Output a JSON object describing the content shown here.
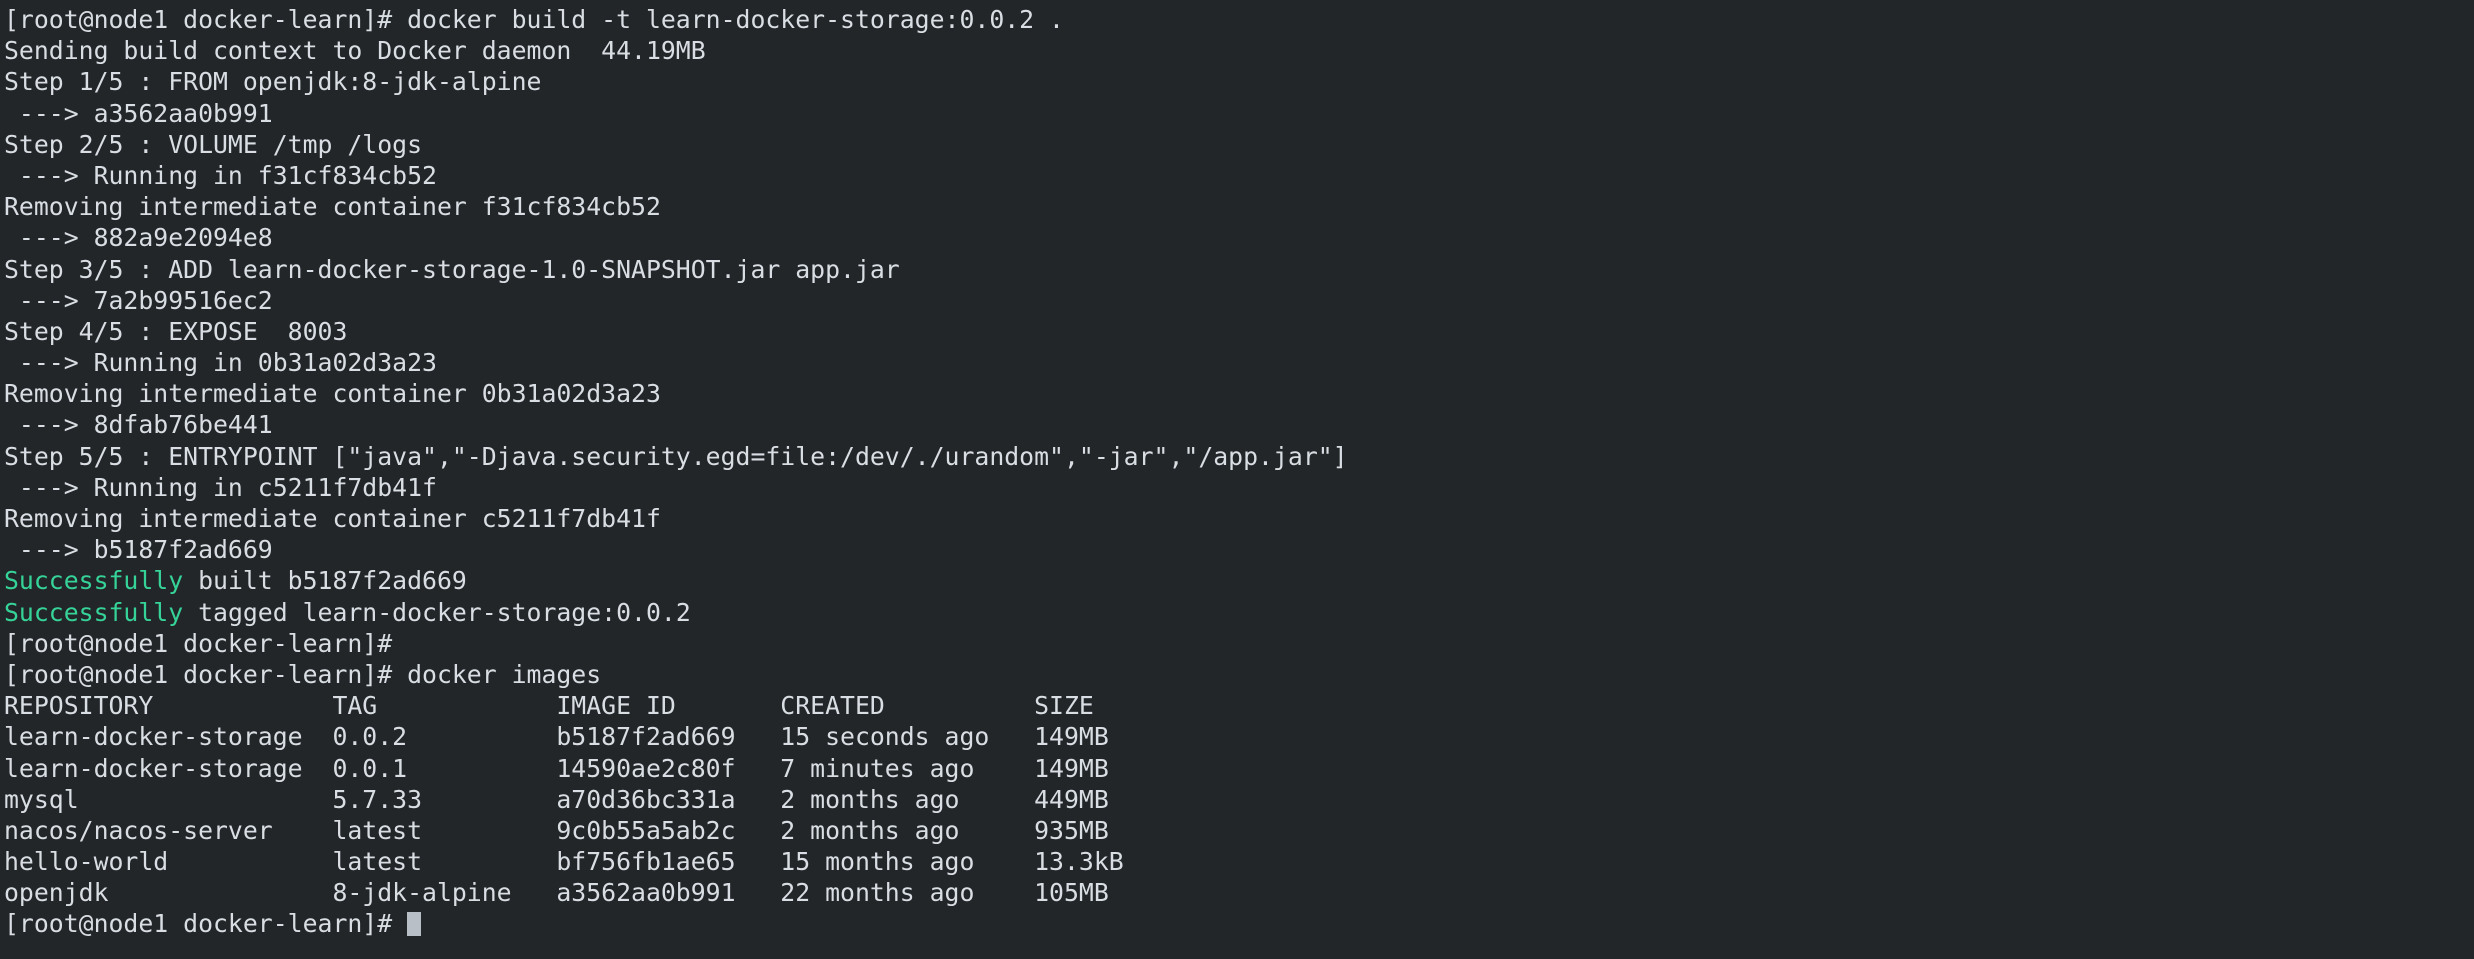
{
  "terminal": {
    "background": "#232629",
    "foreground": "#d8dee3",
    "success_color": "#36d399",
    "cursor_color": "#b9bfc6",
    "prompt": "[root@node1 docker-learn]#",
    "commands": {
      "build": "docker build -t learn-docker-storage:0.0.2 .",
      "images": "docker images"
    },
    "lines": [
      {
        "id": "line-1",
        "segments": [
          {
            "text": "[root@node1 docker-learn]# docker build -t learn-docker-storage:0.0.2 .",
            "color": "default"
          }
        ]
      },
      {
        "id": "line-2",
        "segments": [
          {
            "text": "Sending build context to Docker daemon  44.19MB",
            "color": "default"
          }
        ]
      },
      {
        "id": "line-3",
        "segments": [
          {
            "text": "Step 1/5 : FROM openjdk:8-jdk-alpine",
            "color": "default"
          }
        ]
      },
      {
        "id": "line-4",
        "segments": [
          {
            "text": " ---> a3562aa0b991",
            "color": "default"
          }
        ]
      },
      {
        "id": "line-5",
        "segments": [
          {
            "text": "Step 2/5 : VOLUME /tmp /logs",
            "color": "default"
          }
        ]
      },
      {
        "id": "line-6",
        "segments": [
          {
            "text": " ---> Running in f31cf834cb52",
            "color": "default"
          }
        ]
      },
      {
        "id": "line-7",
        "segments": [
          {
            "text": "Removing intermediate container f31cf834cb52",
            "color": "default"
          }
        ]
      },
      {
        "id": "line-8",
        "segments": [
          {
            "text": " ---> 882a9e2094e8",
            "color": "default"
          }
        ]
      },
      {
        "id": "line-9",
        "segments": [
          {
            "text": "Step 3/5 : ADD learn-docker-storage-1.0-SNAPSHOT.jar app.jar",
            "color": "default"
          }
        ]
      },
      {
        "id": "line-10",
        "segments": [
          {
            "text": " ---> 7a2b99516ec2",
            "color": "default"
          }
        ]
      },
      {
        "id": "line-11",
        "segments": [
          {
            "text": "Step 4/5 : EXPOSE  8003",
            "color": "default"
          }
        ]
      },
      {
        "id": "line-12",
        "segments": [
          {
            "text": " ---> Running in 0b31a02d3a23",
            "color": "default"
          }
        ]
      },
      {
        "id": "line-13",
        "segments": [
          {
            "text": "Removing intermediate container 0b31a02d3a23",
            "color": "default"
          }
        ]
      },
      {
        "id": "line-14",
        "segments": [
          {
            "text": " ---> 8dfab76be441",
            "color": "default"
          }
        ]
      },
      {
        "id": "line-15",
        "segments": [
          {
            "text": "Step 5/5 : ENTRYPOINT [\"java\",\"-Djava.security.egd=file:/dev/./urandom\",\"-jar\",\"/app.jar\"]",
            "color": "default"
          }
        ]
      },
      {
        "id": "line-16",
        "segments": [
          {
            "text": " ---> Running in c5211f7db41f",
            "color": "default"
          }
        ]
      },
      {
        "id": "line-17",
        "segments": [
          {
            "text": "Removing intermediate container c5211f7db41f",
            "color": "default"
          }
        ]
      },
      {
        "id": "line-18",
        "segments": [
          {
            "text": " ---> b5187f2ad669",
            "color": "default"
          }
        ]
      },
      {
        "id": "line-19",
        "segments": [
          {
            "text": "Successfully",
            "color": "green"
          },
          {
            "text": " built b5187f2ad669",
            "color": "default"
          }
        ]
      },
      {
        "id": "line-20",
        "segments": [
          {
            "text": "Successfully",
            "color": "green"
          },
          {
            "text": " tagged learn-docker-storage:0.0.2",
            "color": "default"
          }
        ]
      },
      {
        "id": "line-21",
        "segments": [
          {
            "text": "[root@node1 docker-learn]#",
            "color": "default"
          }
        ]
      },
      {
        "id": "line-22",
        "segments": [
          {
            "text": "[root@node1 docker-learn]# docker images",
            "color": "default"
          }
        ]
      },
      {
        "id": "line-23",
        "segments": [
          {
            "text": "REPOSITORY            TAG            IMAGE ID       CREATED          SIZE",
            "color": "default"
          }
        ]
      },
      {
        "id": "line-24",
        "segments": [
          {
            "text": "learn-docker-storage  0.0.2          b5187f2ad669   15 seconds ago   149MB",
            "color": "default"
          }
        ]
      },
      {
        "id": "line-25",
        "segments": [
          {
            "text": "learn-docker-storage  0.0.1          14590ae2c80f   7 minutes ago    149MB",
            "color": "default"
          }
        ]
      },
      {
        "id": "line-26",
        "segments": [
          {
            "text": "mysql                 5.7.33         a70d36bc331a   2 months ago     449MB",
            "color": "default"
          }
        ]
      },
      {
        "id": "line-27",
        "segments": [
          {
            "text": "nacos/nacos-server    latest         9c0b55a5ab2c   2 months ago     935MB",
            "color": "default"
          }
        ]
      },
      {
        "id": "line-28",
        "segments": [
          {
            "text": "hello-world           latest         bf756fb1ae65   15 months ago    13.3kB",
            "color": "default"
          }
        ]
      },
      {
        "id": "line-29",
        "segments": [
          {
            "text": "openjdk               8-jdk-alpine   a3562aa0b991   22 months ago    105MB",
            "color": "default"
          }
        ]
      }
    ],
    "final_prompt": "[root@node1 docker-learn]# ",
    "images_table": {
      "columns": [
        "REPOSITORY",
        "TAG",
        "IMAGE ID",
        "CREATED",
        "SIZE"
      ],
      "rows": [
        [
          "learn-docker-storage",
          "0.0.2",
          "b5187f2ad669",
          "15 seconds ago",
          "149MB"
        ],
        [
          "learn-docker-storage",
          "0.0.1",
          "14590ae2c80f",
          "7 minutes ago",
          "149MB"
        ],
        [
          "mysql",
          "5.7.33",
          "a70d36bc331a",
          "2 months ago",
          "449MB"
        ],
        [
          "nacos/nacos-server",
          "latest",
          "9c0b55a5ab2c",
          "2 months ago",
          "935MB"
        ],
        [
          "hello-world",
          "latest",
          "bf756fb1ae65",
          "15 months ago",
          "13.3kB"
        ],
        [
          "openjdk",
          "8-jdk-alpine",
          "a3562aa0b991",
          "22 months ago",
          "105MB"
        ]
      ]
    },
    "build_steps": [
      {
        "step": "Step 1/5",
        "instruction": "FROM openjdk:8-jdk-alpine",
        "result_id": "a3562aa0b991"
      },
      {
        "step": "Step 2/5",
        "instruction": "VOLUME /tmp /logs",
        "container": "f31cf834cb52",
        "result_id": "882a9e2094e8"
      },
      {
        "step": "Step 3/5",
        "instruction": "ADD learn-docker-storage-1.0-SNAPSHOT.jar app.jar",
        "result_id": "7a2b99516ec2"
      },
      {
        "step": "Step 4/5",
        "instruction": "EXPOSE  8003",
        "container": "0b31a02d3a23",
        "result_id": "8dfab76be441"
      },
      {
        "step": "Step 5/5",
        "instruction": "ENTRYPOINT [\"java\",\"-Djava.security.egd=file:/dev/./urandom\",\"-jar\",\"/app.jar\"]",
        "container": "c5211f7db41f",
        "result_id": "b5187f2ad669"
      }
    ],
    "build_context_size": "44.19MB",
    "built_image_id": "b5187f2ad669",
    "tagged_image": "learn-docker-storage:0.0.2"
  }
}
